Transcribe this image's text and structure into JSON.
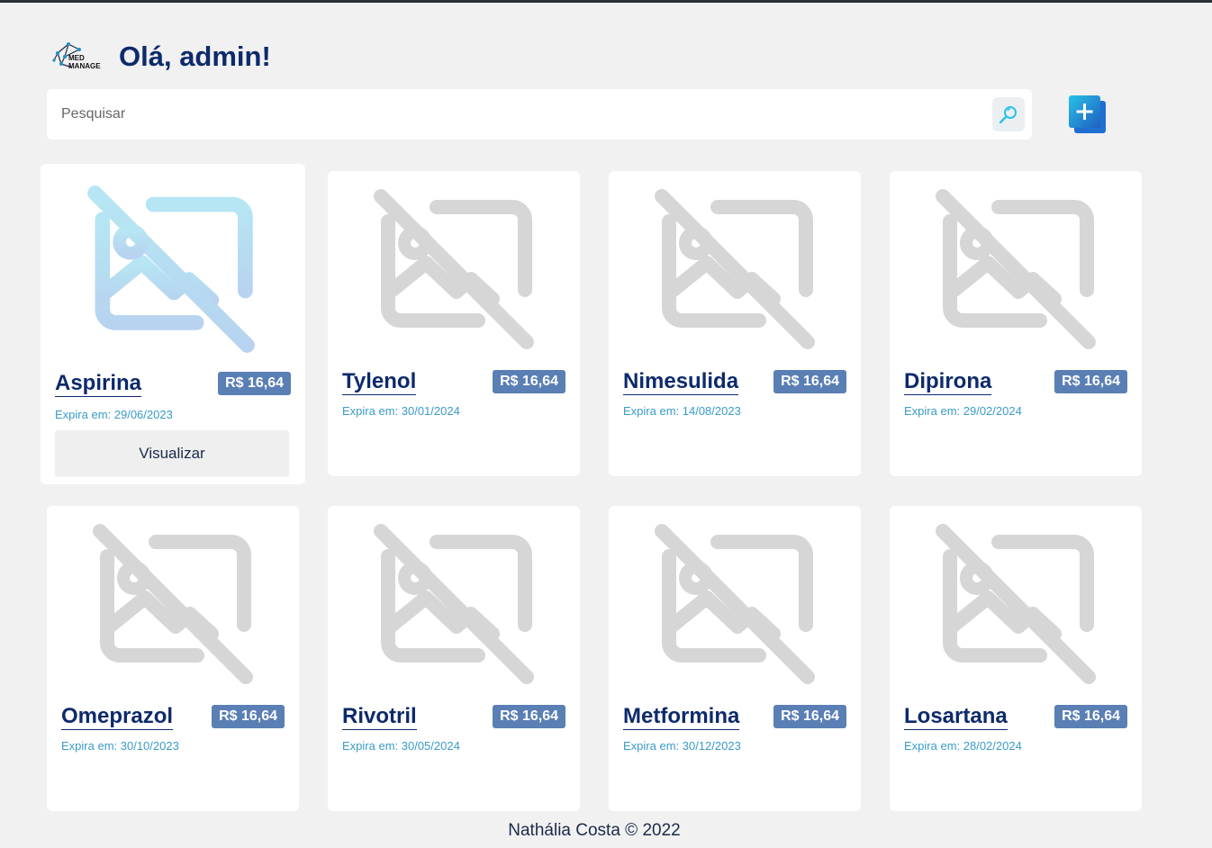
{
  "header": {
    "greeting": "Olá, admin!",
    "logo_text_line1": "MED",
    "logo_text_line2": "MANAGE"
  },
  "search": {
    "placeholder": "Pesquisar"
  },
  "colors": {
    "primary": "#0d2a6b",
    "price_badge": "#5a7fb4",
    "expiry_text": "#3a9bc7",
    "accent": "#29c1e8"
  },
  "products": [
    {
      "name": "Aspirina",
      "price": "R$ 16,64",
      "expiry": "Expira em: 29/06/2023",
      "view_label": "Visualizar",
      "icon": "image-off-icon"
    },
    {
      "name": "Tylenol",
      "price": "R$ 16,64",
      "expiry": "Expira em: 30/01/2024",
      "icon": "image-off-icon"
    },
    {
      "name": "Nimesulida",
      "price": "R$ 16,64",
      "expiry": "Expira em: 14/08/2023",
      "icon": "image-off-icon"
    },
    {
      "name": "Dipirona",
      "price": "R$ 16,64",
      "expiry": "Expira em: 29/02/2024",
      "icon": "image-off-icon"
    },
    {
      "name": "Omeprazol",
      "price": "R$ 16,64",
      "expiry": "Expira em: 30/10/2023",
      "icon": "image-off-icon"
    },
    {
      "name": "Rivotril",
      "price": "R$ 16,64",
      "expiry": "Expira em: 30/05/2024",
      "icon": "image-off-icon"
    },
    {
      "name": "Metformina",
      "price": "R$ 16,64",
      "expiry": "Expira em: 30/12/2023",
      "icon": "image-off-icon"
    },
    {
      "name": "Losartana",
      "price": "R$ 16,64",
      "expiry": "Expira em: 28/02/2024",
      "icon": "image-off-icon"
    }
  ],
  "footer": {
    "text": "Nathália Costa © 2022"
  }
}
